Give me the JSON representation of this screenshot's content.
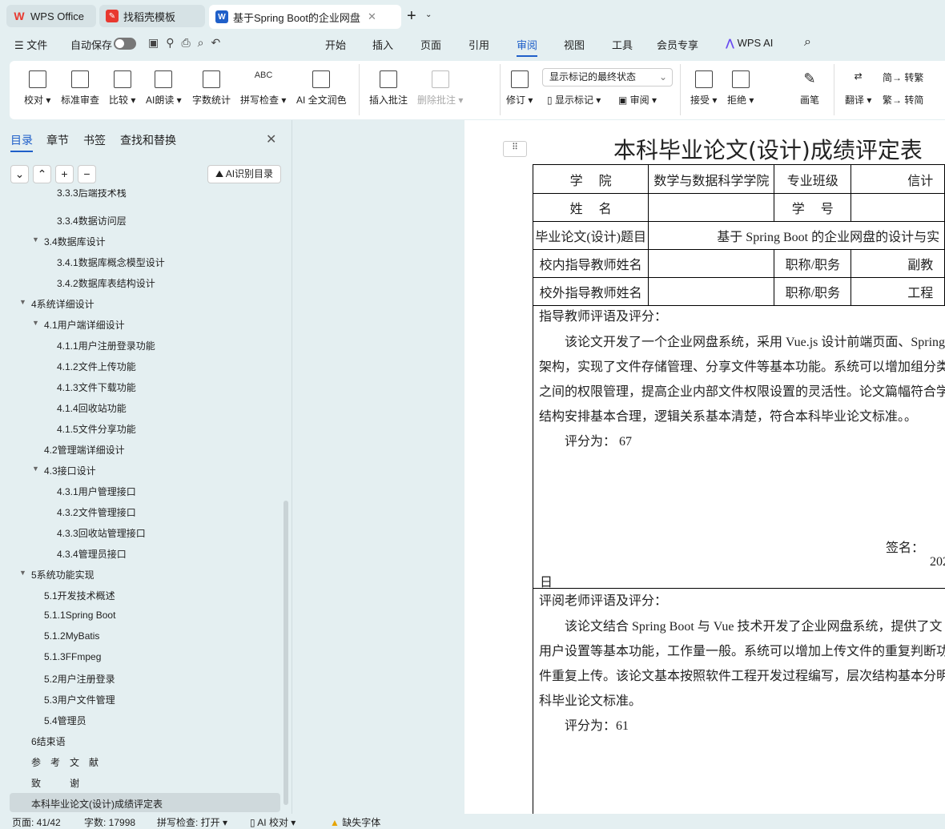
{
  "tabs": [
    {
      "label": "WPS Office"
    },
    {
      "label": "找稻壳模板"
    },
    {
      "label": "基于Spring Boot的企业网盘"
    }
  ],
  "menubar": {
    "file": "文件",
    "autosave": "自动保存",
    "items": [
      "开始",
      "插入",
      "页面",
      "引用",
      "审阅",
      "视图",
      "工具",
      "会员专享"
    ],
    "active": "审阅",
    "wps_ai": "WPS AI"
  },
  "ribbon": {
    "proof": "校对",
    "std": "标准审查",
    "compare": "比较",
    "ai_read": "AI朗读",
    "wordcount": "字数统计",
    "spell": "拼写检查",
    "ai_polish": "AI 全文润色",
    "insert_comment": "插入批注",
    "delete_comment": "删除批注",
    "revise": "修订",
    "markup_select": "显示标记的最终状态",
    "show_markup": "显示标记",
    "review": "审阅",
    "accept": "接受",
    "reject": "拒绝",
    "pen": "画笔",
    "translate": "翻译",
    "to_trad": "转繁",
    "to_simp": "转简"
  },
  "sidebar": {
    "tabs": [
      "目录",
      "章节",
      "书签",
      "查找和替换"
    ],
    "ai_toc": "AI识别目录",
    "items": [
      {
        "label": "3.3.3后端技术栈",
        "level": 3
      },
      {
        "label": "3.3.4数据访问层",
        "level": 3
      },
      {
        "label": "3.4数据库设计",
        "level": 2,
        "expanded": true
      },
      {
        "label": "3.4.1数据库概念模型设计",
        "level": 3
      },
      {
        "label": "3.4.2数据库表结构设计",
        "level": 3
      },
      {
        "label": "4系统详细设计",
        "level": 1,
        "expanded": true
      },
      {
        "label": "4.1用户端详细设计",
        "level": 2,
        "expanded": true
      },
      {
        "label": "4.1.1用户注册登录功能",
        "level": 3
      },
      {
        "label": "4.1.2文件上传功能",
        "level": 3
      },
      {
        "label": "4.1.3文件下载功能",
        "level": 3
      },
      {
        "label": "4.1.4回收站功能",
        "level": 3
      },
      {
        "label": "4.1.5文件分享功能",
        "level": 3
      },
      {
        "label": "4.2管理端详细设计",
        "level": 2
      },
      {
        "label": "4.3接口设计",
        "level": 2,
        "expanded": true
      },
      {
        "label": "4.3.1用户管理接口",
        "level": 3
      },
      {
        "label": "4.3.2文件管理接口",
        "level": 3
      },
      {
        "label": "4.3.3回收站管理接口",
        "level": 3
      },
      {
        "label": "4.3.4管理员接口",
        "level": 3
      },
      {
        "label": "5系统功能实现",
        "level": 1,
        "expanded": true
      },
      {
        "label": "5.1开发技术概述",
        "level": 2
      },
      {
        "label": "5.1.1Spring Boot",
        "level": 2
      },
      {
        "label": "5.1.2MyBatis",
        "level": 2
      },
      {
        "label": "5.1.3FFmpeg",
        "level": 2
      },
      {
        "label": "5.2用户注册登录",
        "level": 2
      },
      {
        "label": "5.3用户文件管理",
        "level": 2
      },
      {
        "label": "5.4管理员",
        "level": 2
      },
      {
        "label": "6结束语",
        "level": 1
      },
      {
        "label": "参　考　文　献",
        "level": 1
      },
      {
        "label": "致　　　谢",
        "level": 1
      },
      {
        "label": "本科毕业论文(设计)成绩评定表",
        "level": 1,
        "selected": true
      }
    ]
  },
  "doc": {
    "title": "本科毕业论文(设计)成绩评定表",
    "rows": [
      [
        "学　 院",
        "数学与数据科学学院",
        "专业班级",
        "信计"
      ],
      [
        "姓　 名",
        "",
        "学　 号",
        ""
      ],
      [
        "毕业论文(设计)题目",
        "基于 Spring Boot 的企业网盘的设计与实"
      ],
      [
        "校内指导教师姓名",
        "",
        "职称/职务",
        "副教"
      ],
      [
        "校外指导教师姓名",
        "",
        "职称/职务",
        "工程"
      ]
    ],
    "advisor_heading": "指导教师评语及评分：",
    "advisor_lines": [
      "该论文开发了一个企业网盘系统，采用 Vue.js 设计前端页面、Spring",
      "架构，实现了文件存储管理、分享文件等基本功能。系统可以增加组分类",
      "之间的权限管理，提高企业内部文件权限设置的灵活性。论文篇幅符合学",
      "结构安排基本合理，逻辑关系基本清楚，符合本科毕业论文标准。。"
    ],
    "advisor_score": "评分为：  67",
    "sign": "签名：",
    "year": "202",
    "day": "日",
    "reviewer_heading": "评阅老师评语及评分：",
    "reviewer_lines": [
      "该论文结合 Spring Boot 与 Vue 技术开发了企业网盘系统，提供了文",
      "用户设置等基本功能，工作量一般。系统可以增加上传文件的重复判断功",
      "件重复上传。该论文基本按照软件工程开发过程编写，层次结构基本分明",
      "科毕业论文标准。"
    ],
    "reviewer_score": "评分为：61"
  },
  "status": {
    "page": "页面: 41/42",
    "words": "字数: 17998",
    "spell": "拼写检查: 打开",
    "ai": "AI 校对",
    "font": "缺失字体"
  },
  "colors": {
    "accent": "#1f5fc9",
    "wps_red": "#e8382f"
  }
}
